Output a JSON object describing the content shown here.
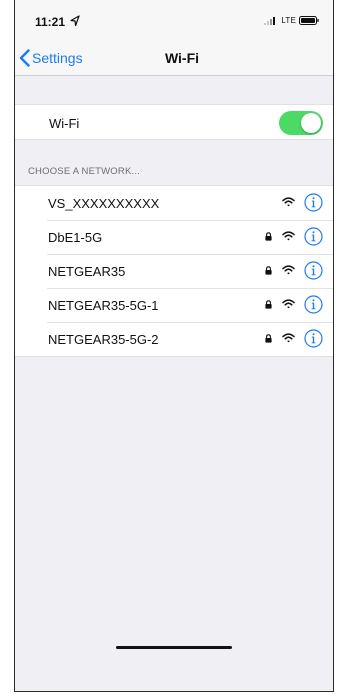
{
  "status_bar": {
    "time": "11:21",
    "carrier": "LTE",
    "location_icon": "location-arrow-icon",
    "signal_icon": "cellular-signal-icon",
    "battery_icon": "battery-icon"
  },
  "nav": {
    "back_label": "Settings",
    "back_icon": "chevron-left-icon",
    "title": "Wi-Fi"
  },
  "wifi_toggle": {
    "label": "Wi-Fi",
    "on": true
  },
  "section_header": "CHOOSE A NETWORK...",
  "networks": [
    {
      "name": "VS_XXXXXXXXXX",
      "secured": false
    },
    {
      "name": "DbE1-5G",
      "secured": true
    },
    {
      "name": "NETGEAR35",
      "secured": true
    },
    {
      "name": "NETGEAR35-5G-1",
      "secured": true
    },
    {
      "name": "NETGEAR35-5G-2",
      "secured": true
    }
  ],
  "colors": {
    "accent": "#1a7cf5",
    "toggle_on": "#4cd964",
    "background": "#efeff4"
  }
}
